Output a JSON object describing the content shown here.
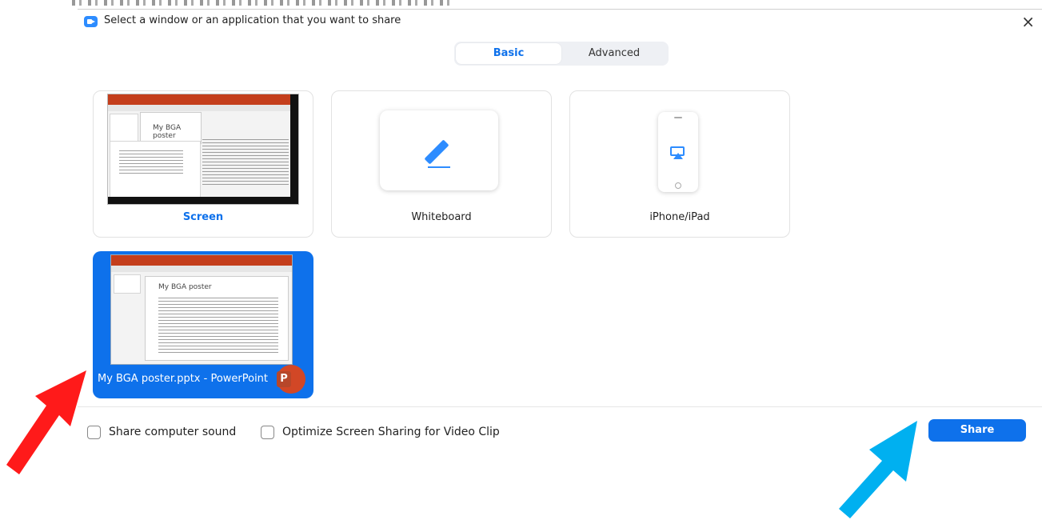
{
  "dialog": {
    "title": "Select a window or an application that you want to share",
    "close_label": "×"
  },
  "tabs": [
    {
      "label": "Basic",
      "selected": true
    },
    {
      "label": "Advanced",
      "selected": false
    }
  ],
  "share_options": [
    {
      "label": "Screen",
      "icon": "screen-preview",
      "highlighted": true
    },
    {
      "label": "Whiteboard",
      "icon": "pencil-icon"
    },
    {
      "label": "iPhone/iPad",
      "icon": "airplay-icon"
    }
  ],
  "windows": [
    {
      "label": "My BGA poster.pptx - PowerPoint",
      "icon": "powerpoint-icon",
      "icon_text": "P",
      "selected": true,
      "slide_title": "My BGA poster"
    }
  ],
  "screen_preview_slide_title": "My BGA poster",
  "footer": {
    "share_sound_label": "Share computer sound",
    "optimize_label": "Optimize Screen Sharing for Video Clip",
    "share_button": "Share"
  },
  "colors": {
    "accent": "#0e71eb",
    "annotation_red": "#ff1a1a",
    "annotation_blue": "#00b0f0"
  }
}
